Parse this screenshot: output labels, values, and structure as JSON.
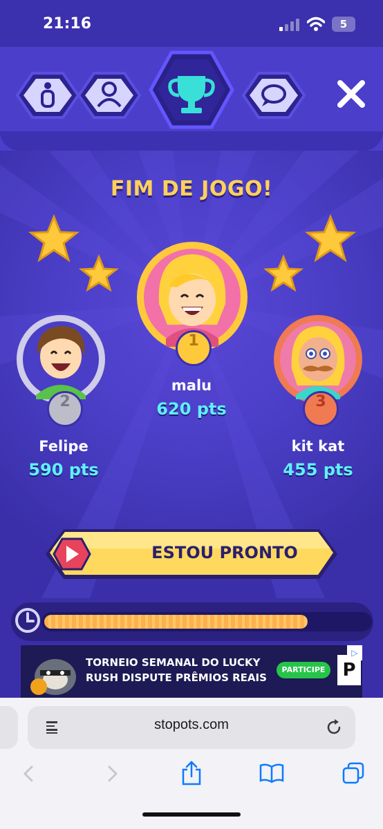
{
  "status_bar": {
    "time": "21:16",
    "battery": "5"
  },
  "nav": {
    "tabs": [
      {
        "name": "info",
        "icon": "info-icon"
      },
      {
        "name": "players",
        "icon": "user-icon"
      },
      {
        "name": "ranking",
        "icon": "trophy-icon",
        "active": true
      },
      {
        "name": "chat",
        "icon": "chat-icon"
      }
    ],
    "close_icon": "close-icon"
  },
  "game": {
    "title": "FIM DE JOGO!",
    "podium": [
      {
        "rank": "1",
        "name": "malu",
        "points": "620 pts"
      },
      {
        "rank": "2",
        "name": "Felipe",
        "points": "590 pts"
      },
      {
        "rank": "3",
        "name": "kit kat",
        "points": "455 pts"
      }
    ],
    "ready_button": "ESTOU PRONTO"
  },
  "timer": {
    "progress": 0.81
  },
  "ad": {
    "headline": "TORNEIO SEMANAL DO LUCKY RUSH DISPUTE PRÊMIOS REAIS",
    "cta": "PARTICIPE",
    "brand_letter": "P",
    "info_icon": "play-triangle-icon"
  },
  "browser": {
    "url": "stopots.com"
  },
  "colors": {
    "accent_yellow": "#ffd15a",
    "points_cyan": "#5ff0ff",
    "background_purple": "#3a2fa8",
    "button_yellow": "#ffd95e",
    "button_red": "#e8435c"
  }
}
